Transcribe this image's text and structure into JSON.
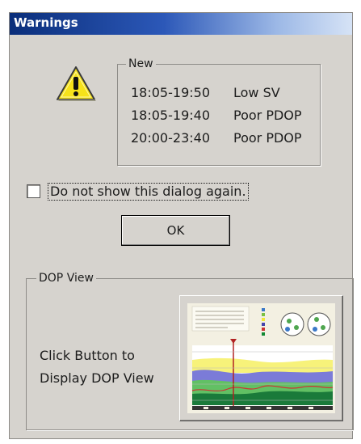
{
  "dialog": {
    "title": "Warnings",
    "new_group_label": "New",
    "warnings": [
      {
        "time": "18:05-19:50",
        "message": "Low SV"
      },
      {
        "time": "18:05-19:40",
        "message": "Poor PDOP"
      },
      {
        "time": "20:00-23:40",
        "message": "Poor PDOP"
      }
    ],
    "checkbox_label": "Do not show this dialog again.",
    "checkbox_checked": false,
    "ok_label": "OK",
    "dop_group_label": "DOP View",
    "dop_text_line1": "Click Button to",
    "dop_text_line2": "Display DOP View",
    "dop_button_icon": "dop-chart-thumbnail-icon"
  },
  "colors": {
    "title_gradient_start": "#0a2e7a",
    "title_gradient_end": "#d6e3f6",
    "dialog_background": "#d6d3ce",
    "warning_icon_fill": "#f6e21a"
  }
}
